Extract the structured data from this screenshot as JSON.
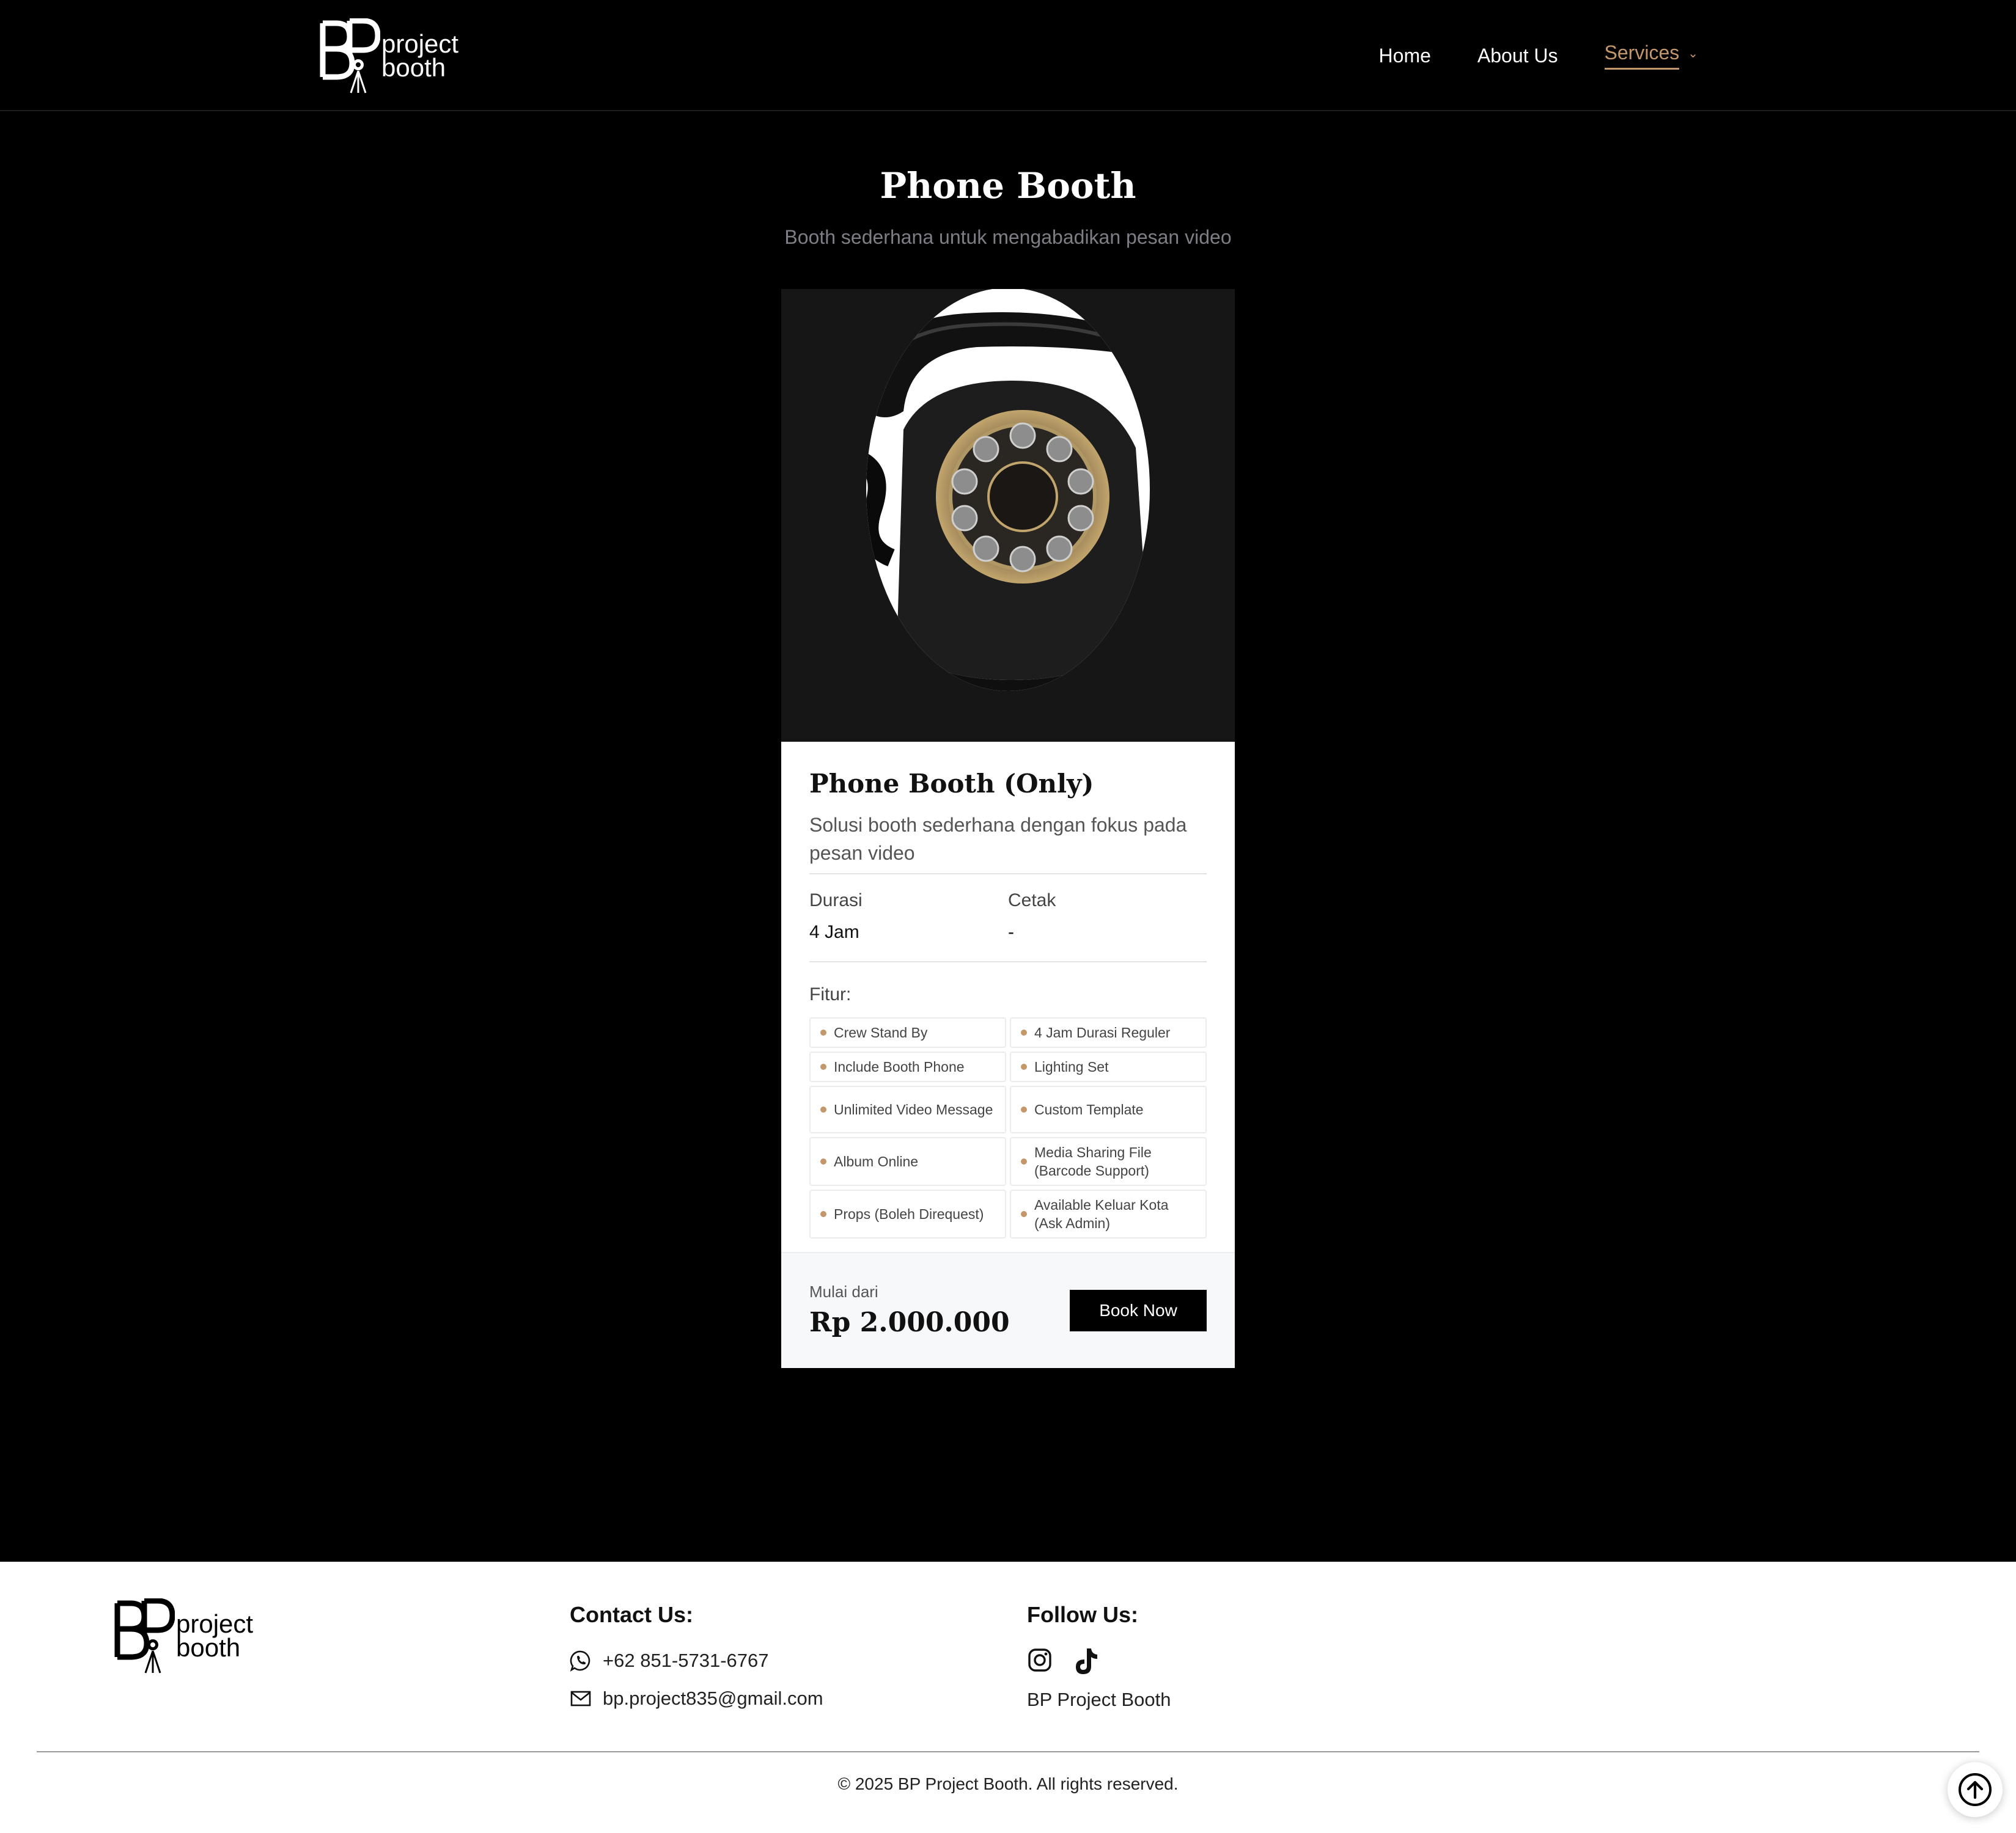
{
  "brand": {
    "logo_word_1": "project",
    "logo_word_2": "booth",
    "logo_monogram": "BP"
  },
  "nav": {
    "items": [
      {
        "label": "Home"
      },
      {
        "label": "About Us"
      },
      {
        "label": "Services"
      }
    ],
    "active": "Services"
  },
  "page": {
    "title": "Phone Booth",
    "subtitle": "Booth sederhana untuk mengabadikan pesan video"
  },
  "card": {
    "image_icon": "rotary-telephone-photo",
    "title": "Phone Booth (Only)",
    "description": "Solusi booth sederhana dengan fokus pada pesan video",
    "specs": [
      {
        "label": "Durasi",
        "value": "4 Jam"
      },
      {
        "label": "Cetak",
        "value": "-"
      }
    ],
    "features_label": "Fitur:",
    "features": [
      "Crew Stand By",
      "4 Jam Durasi Reguler",
      "Include Booth Phone",
      "Lighting Set",
      "Unlimited Video Message",
      "Custom Template",
      "Album Online",
      "Media Sharing File (Barcode Support)",
      "Props (Boleh Direquest)",
      "Available Keluar Kota (Ask Admin)"
    ],
    "price_prefix": "Mulai dari",
    "price": "Rp 2.000.000",
    "book_label": "Book Now"
  },
  "footer": {
    "contact_heading": "Contact Us:",
    "phone": "+62 851-5731-6767",
    "email": "bp.project835@gmail.com",
    "follow_heading": "Follow Us:",
    "social_icons": [
      "instagram-icon",
      "tiktok-icon"
    ],
    "social_name": "BP Project Booth",
    "copyright": "© 2025 BP Project Booth. All rights reserved."
  },
  "colors": {
    "accent": "#c4976a",
    "background": "#000000",
    "card": "#ffffff"
  }
}
